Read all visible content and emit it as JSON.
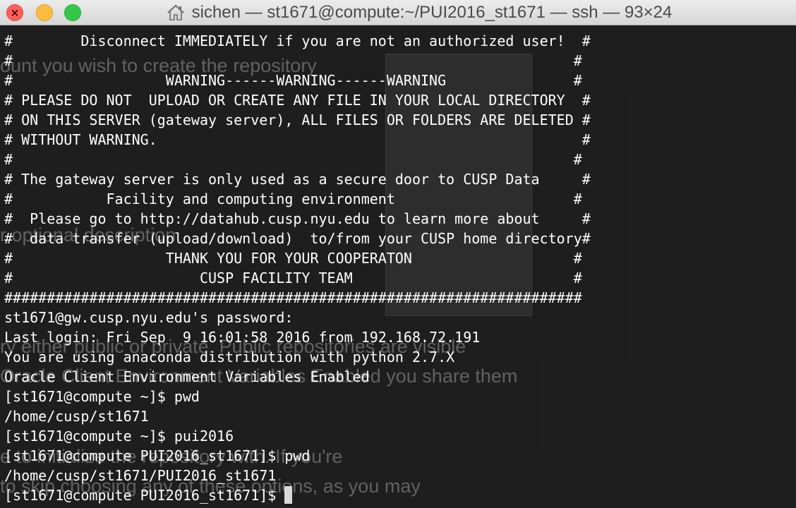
{
  "window": {
    "title": "sichen — st1671@compute:~/PUI2016_st1671 — ssh — 93×24",
    "icon": "home-icon"
  },
  "colors": {
    "terminal_bg": "#1e1e1e",
    "text": "#ffffff",
    "close": "#fc605c",
    "minimize": "#fdbc40",
    "maximize": "#34c84a"
  },
  "ghost": {
    "line1": "ount you wish to create the repository",
    "line2": "r optional description",
    "line3": "ry either public or private. Public repositories are visible",
    "line4": "Oracle Client Environment Variables Enabled you share them",
    "line5": "e to initialize the repository with. If you're",
    "line6": "to skip choosing any of these options, as you may"
  },
  "terminal": {
    "lines": [
      "#        Disconnect IMMEDIATELY if you are not an authorized user!  #",
      "#                                                                  #",
      "#                  WARNING------WARNING------WARNING               #",
      "# PLEASE DO NOT  UPLOAD OR CREATE ANY FILE IN YOUR LOCAL DIRECTORY  #",
      "# ON THIS SERVER (gateway server), ALL FILES OR FOLDERS ARE DELETED #",
      "# WITHOUT WARNING.                                                  #",
      "#                                                                  #",
      "# The gateway server is only used as a secure door to CUSP Data     #",
      "#           Facility and computing environment                     #",
      "#  Please go to http://datahub.cusp.nyu.edu to learn more about     #",
      "#  data transfer (upload/download)  to/from your CUSP home directory#",
      "#                  THANK YOU FOR YOUR COOPERATON                   #",
      "#                      CUSP FACILITY TEAM                          #",
      "####################################################################",
      "st1671@gw.cusp.nyu.edu's password:",
      "Last login: Fri Sep  9 16:01:58 2016 from 192.168.72.191",
      "You are using anaconda distribution with python 2.7.X",
      "Oracle Client Environment Variables Enabled",
      "[st1671@compute ~]$ pwd",
      "/home/cusp/st1671",
      "[st1671@compute ~]$ pui2016",
      "[st1671@compute PUI2016_st1671]$ pwd",
      "/home/cusp/st1671/PUI2016_st1671"
    ],
    "prompt": "[st1671@compute PUI2016_st1671]$ "
  }
}
